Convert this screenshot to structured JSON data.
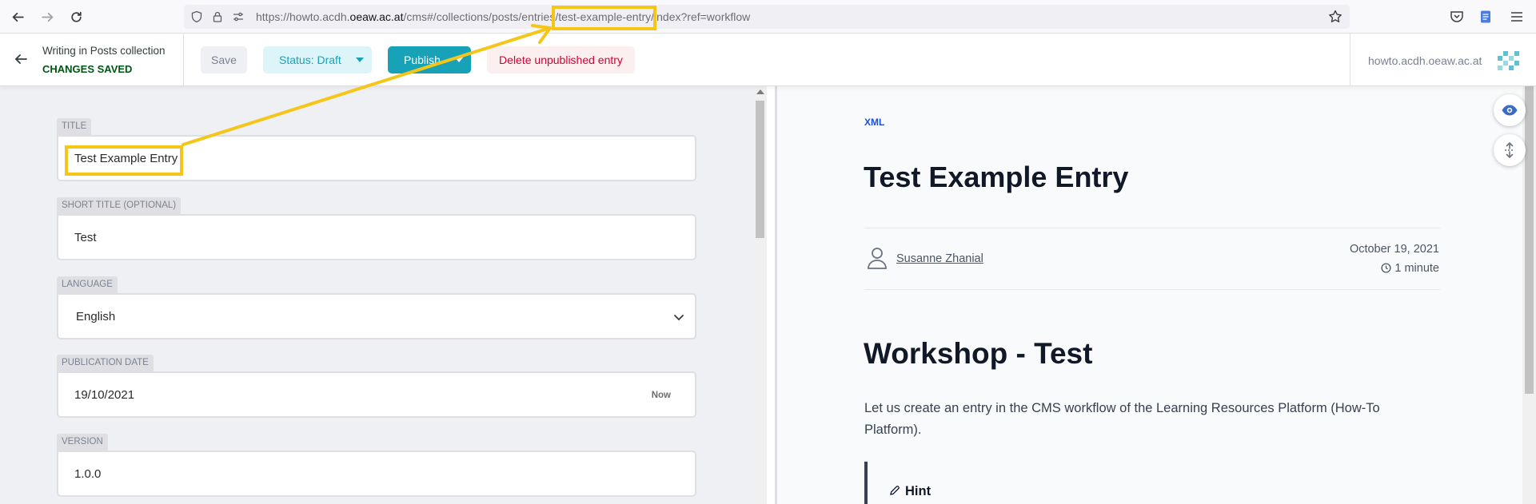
{
  "browser": {
    "url_prefix": "https://howto.acdh.",
    "url_host": "oeaw.ac.at",
    "url_path": "/cms#/collections/posts/entries/test-example-entry/index?ref=workflow",
    "icons": [
      "back-arrow-icon",
      "forward-arrow-icon",
      "reload-icon",
      "shield-icon",
      "lock-icon",
      "permissions-icon",
      "bookmark-star-icon",
      "pocket-icon",
      "extension-icon",
      "menu-icon"
    ]
  },
  "header": {
    "collection_title": "Writing in Posts collection",
    "save_status": "CHANGES SAVED",
    "save_label": "Save",
    "status_label": "Status: Draft",
    "publish_label": "Publish",
    "delete_label": "Delete unpublished entry",
    "site_url": "howto.acdh.oeaw.ac.at"
  },
  "editor": {
    "fields": [
      {
        "label": "TITLE",
        "value": "Test Example Entry"
      },
      {
        "label": "SHORT TITLE (OPTIONAL)",
        "value": "Test"
      },
      {
        "label": "LANGUAGE",
        "value": "English"
      },
      {
        "label": "PUBLICATION DATE",
        "value": "19/10/2021",
        "action": "Now"
      },
      {
        "label": "VERSION",
        "value": "1.0.0"
      }
    ]
  },
  "preview": {
    "tag": "XML",
    "title": "Test Example Entry",
    "author": "Susanne Zhanial",
    "date": "October 19, 2021",
    "read_time": "1 minute",
    "heading": "Workshop - Test",
    "paragraph": "Let us create an entry in the CMS workflow of the Learning Resources Platform (How-To Platform).",
    "hint_label": "Hint"
  },
  "colors": {
    "accent_teal": "#17a2b8",
    "saved_green": "#005614",
    "delete_red": "#d60032",
    "annotation_yellow": "#f5c518",
    "tag_blue": "#1d4ed8"
  }
}
